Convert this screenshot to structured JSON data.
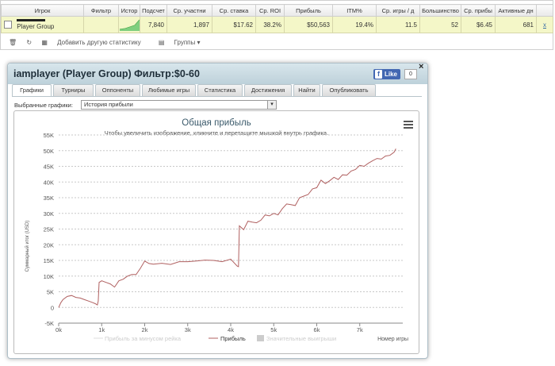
{
  "stats_table": {
    "headers": [
      "Игрок",
      "Фильтр",
      "Истор",
      "Подсчет",
      "Ср. участни",
      "Ср. ставка",
      "Ср. ROI",
      "Прибыль",
      "ITM%",
      "Ср. игры / д",
      "Большинство",
      "Ср. прибы",
      "Активные дн",
      ""
    ],
    "row": {
      "player": "Player Group",
      "filter": "",
      "count": "7,840",
      "avg_entrants": "1,897",
      "avg_stake": "$17.62",
      "avg_roi": "38.2%",
      "profit": "$50,563",
      "itm": "19.4%",
      "games_per_day": "11.5",
      "majority": "52",
      "avg_profit": "$6.45",
      "active_days": "681",
      "remove": "x"
    }
  },
  "statbar": {
    "add_stats": "Добавить другую статистику",
    "groups": "Группы ▾"
  },
  "dialog": {
    "title": "iamplayer (Player Group) Фильтр:$0-60",
    "like_label": "Like",
    "like_count": "0",
    "close": "×",
    "tabs": [
      "Графики",
      "Турниры",
      "Оппоненты",
      "Любимые игры",
      "Статистика",
      "Достижения",
      "Найти",
      "Опубликовать"
    ],
    "selected_tab": "Графики",
    "select_label": "Выбранные графики:",
    "select_value": "История прибыли"
  },
  "chart_data": {
    "type": "line",
    "title": "Общая прибыль",
    "subtitle": "Чтобы увеличить изображение, кликните и перетащите мышкой внутрь графика.",
    "xlabel": "Номер игры",
    "ylabel": "Суммарный итог (USD)",
    "xlim": [
      0,
      8000
    ],
    "ylim": [
      -5000,
      55000
    ],
    "x_ticks": [
      "0k",
      "1k",
      "2k",
      "3k",
      "4k",
      "5k",
      "6k",
      "7k"
    ],
    "y_ticks": [
      "-5K",
      "0",
      "5K",
      "10K",
      "15K",
      "20K",
      "25K",
      "30K",
      "35K",
      "40K",
      "45K",
      "50K",
      "55K"
    ],
    "grid": true,
    "legend_position": "bottom",
    "legend": [
      "Прибыль за минусом рейка",
      "Прибыль",
      "Значительные выигрыши"
    ],
    "colors": {
      "profit": "#b06060",
      "rake": "#dddddd",
      "big": "#cccccc",
      "title": "#3b5a6b"
    },
    "series": [
      {
        "name": "Прибыль",
        "x": [
          0,
          50,
          100,
          200,
          300,
          400,
          500,
          600,
          700,
          800,
          850,
          900,
          920,
          940,
          1000,
          1100,
          1200,
          1300,
          1400,
          1500,
          1550,
          1600,
          1700,
          1800,
          1900,
          2000,
          2100,
          2200,
          2400,
          2600,
          2800,
          3000,
          3200,
          3400,
          3600,
          3800,
          4000,
          4150,
          4180,
          4200,
          4300,
          4400,
          4500,
          4600,
          4700,
          4800,
          4900,
          5000,
          5100,
          5200,
          5300,
          5400,
          5500,
          5600,
          5700,
          5800,
          5900,
          6000,
          6100,
          6200,
          6300,
          6400,
          6500,
          6600,
          6700,
          6800,
          6900,
          7000,
          7100,
          7200,
          7300,
          7400,
          7500,
          7600,
          7700,
          7800,
          7840
        ],
        "y": [
          0,
          1500,
          2500,
          3500,
          3800,
          3200,
          3000,
          2500,
          2000,
          1500,
          1200,
          800,
          2000,
          8000,
          8500,
          8000,
          7500,
          6500,
          8500,
          9000,
          9500,
          10000,
          10500,
          10500,
          12500,
          14800,
          14000,
          13800,
          14100,
          13700,
          14600,
          14600,
          14800,
          15100,
          15000,
          14600,
          15400,
          13200,
          13000,
          26000,
          24800,
          27500,
          27200,
          27000,
          27800,
          29500,
          29200,
          30000,
          29500,
          31500,
          33000,
          32800,
          32500,
          35000,
          35500,
          36000,
          37800,
          38200,
          40600,
          39500,
          40400,
          41500,
          40800,
          42300,
          42200,
          43500,
          44000,
          45300,
          45000,
          46000,
          46800,
          47500,
          47300,
          48300,
          48500,
          49500,
          50600
        ]
      }
    ]
  }
}
